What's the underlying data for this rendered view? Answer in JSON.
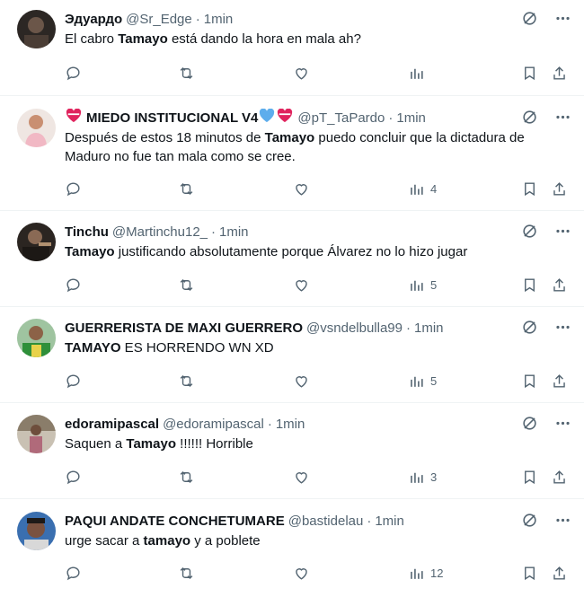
{
  "tweets": [
    {
      "name": "Эдуардо",
      "handle": "@Sr_Edge",
      "time": "1min",
      "pre": "El cabro ",
      "bold": "Tamayo",
      "post": " está dando la hora en mala ah?",
      "views": "",
      "avatar": "#5b4a3f"
    },
    {
      "name": "MIEDO INSTITUCIONAL V4",
      "handle": "@pT_TaPardo",
      "time": "1min",
      "pre": "Después de estos 18 minutos de ",
      "bold": "Tamayo",
      "post": " puedo concluir que la dictadura de Maduro no fue tan mala como se cree.",
      "views": "4",
      "avatar": "#d9b7a8"
    },
    {
      "name": "Tinchu",
      "handle": "@Martinchu12_",
      "time": "1min",
      "pre": "",
      "bold": "Tamayo",
      "post": " justificando absolutamente porque Álvarez no lo hizo jugar",
      "views": "5",
      "avatar": "#3a2f2a"
    },
    {
      "name": "GUERRERISTA DE MAXI GUERRERO",
      "handle": "@vsndelbulla99",
      "time": "1min",
      "pre": "",
      "bold": "TAMAYO",
      "post": " ES HORRENDO WN XD",
      "views": "5",
      "avatar": "#4c8f3c"
    },
    {
      "name": "edoramipascal",
      "handle": "@edoramipascal",
      "time": "1min",
      "pre": "Saquen a ",
      "bold": "Tamayo",
      "post": " !!!!!! Horrible",
      "views": "3",
      "avatar": "#a99a84"
    },
    {
      "name": "PAQUI ANDATE CONCHETUMARE",
      "handle": "@bastidelau",
      "time": "1min",
      "pre": "urge sacar a ",
      "bold": "tamayo",
      "post": " y a poblete",
      "views": "12",
      "avatar": "#5a4030"
    }
  ],
  "colors": {
    "text": "#0f1419",
    "secondary": "#536471",
    "divider": "#eff3f4",
    "heart_emoji": "#e0245e",
    "blue_heart": "#5dadec"
  },
  "icons": [
    "reply-icon",
    "retweet-icon",
    "like-icon",
    "views-icon",
    "bookmark-icon",
    "share-icon",
    "grok-icon",
    "more-icon"
  ]
}
